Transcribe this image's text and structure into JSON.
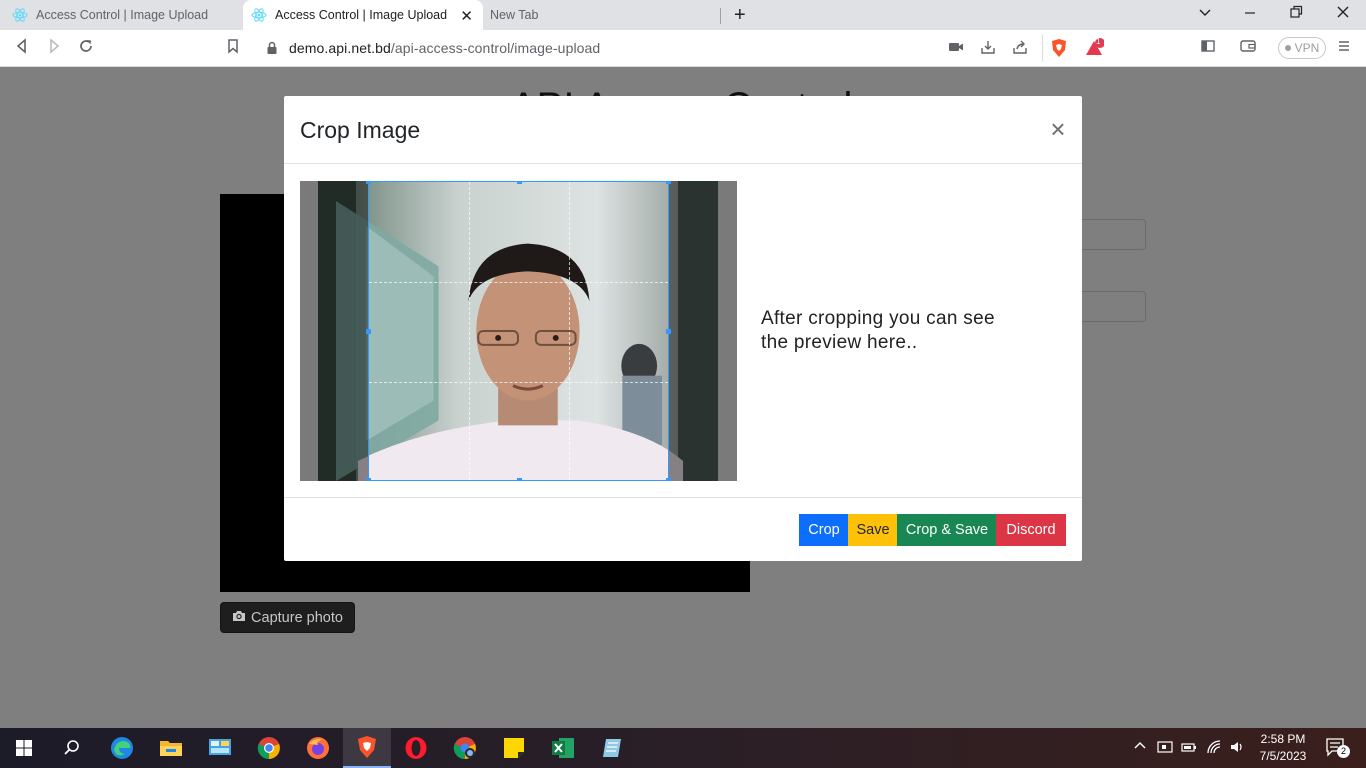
{
  "browser": {
    "tabs": [
      {
        "title": "Access Control | Image Upload",
        "active": false
      },
      {
        "title": "Access Control | Image Upload",
        "active": true
      },
      {
        "title": "New Tab",
        "active": false
      }
    ],
    "url_host": "demo.api.net.bd",
    "url_path": "/api-access-control/image-upload",
    "vpn_label": "VPN",
    "brave_badge": "1",
    "accent_color": "#1a73e8"
  },
  "page": {
    "title": "API Access Control",
    "capture_label": "Capture photo"
  },
  "modal": {
    "title": "Crop Image",
    "close_symbol": "×",
    "preview_text": "After cropping you can see the preview here..",
    "buttons": {
      "crop": "Crop",
      "save": "Save",
      "crop_save": "Crop & Save",
      "discord": "Discord"
    },
    "colors": {
      "crop": "#0d6efd",
      "save": "#ffc107",
      "crop_save": "#198754",
      "discord": "#dc3545",
      "crop_border": "#3399ff"
    }
  },
  "taskbar": {
    "time": "2:58 PM",
    "date": "7/5/2023",
    "notification_count": "2",
    "apps": [
      "start-icon",
      "search-icon",
      "edge-icon",
      "file-explorer-icon",
      "control-panel-icon",
      "chrome-icon",
      "firefox-icon",
      "brave-icon",
      "opera-icon",
      "chrome-canary-icon",
      "sticky-notes-icon",
      "excel-icon",
      "notepad-icon"
    ]
  }
}
